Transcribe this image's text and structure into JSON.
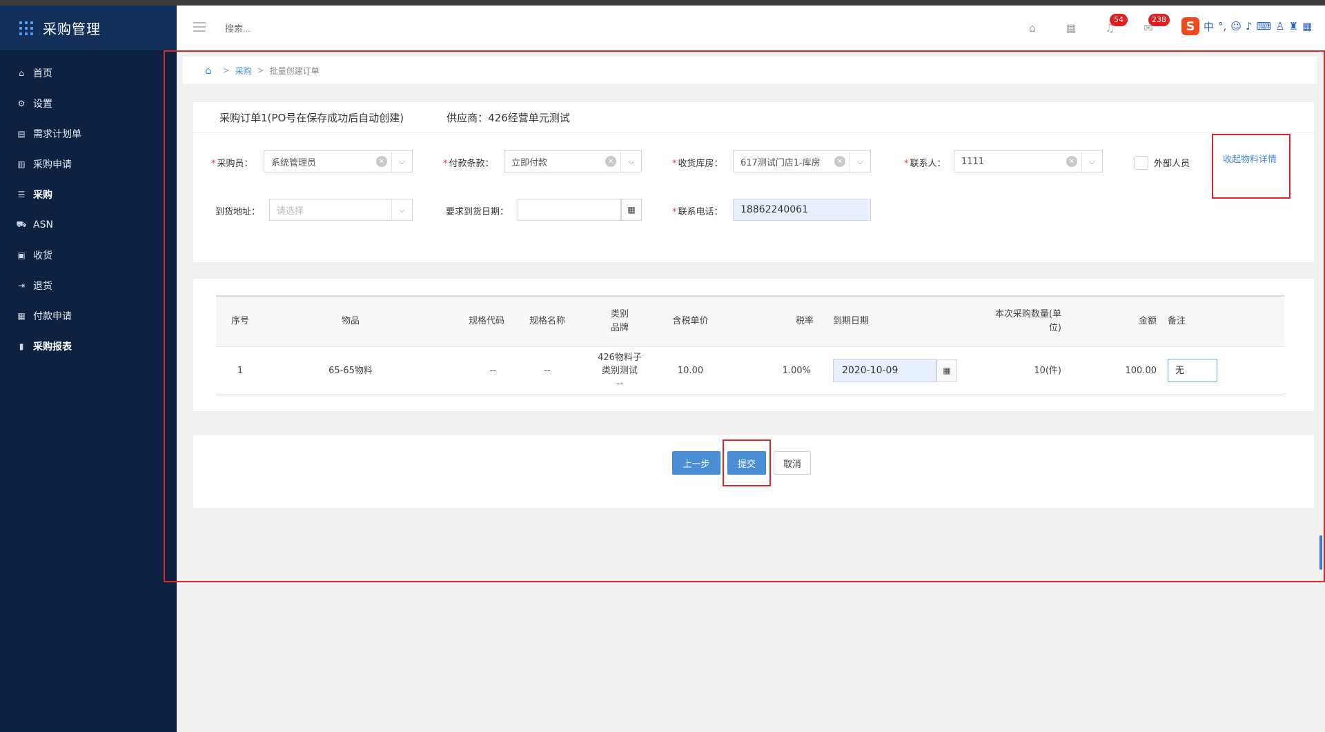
{
  "app": {
    "title": "采购管理"
  },
  "sidebar": {
    "items": [
      {
        "label": "首页",
        "icon": "home-icon"
      },
      {
        "label": "设置",
        "icon": "gear-icon"
      },
      {
        "label": "需求计划单",
        "icon": "document-icon"
      },
      {
        "label": "采购申请",
        "icon": "form-icon"
      },
      {
        "label": "采购",
        "icon": "list-icon"
      },
      {
        "label": "ASN",
        "icon": "truck-icon"
      },
      {
        "label": "收货",
        "icon": "inbox-icon"
      },
      {
        "label": "退货",
        "icon": "exit-icon"
      },
      {
        "label": "付款申请",
        "icon": "payment-icon"
      },
      {
        "label": "采购报表",
        "icon": "bar-chart-icon"
      }
    ]
  },
  "header": {
    "search_placeholder": "搜索...",
    "notif_count": "54",
    "message_count": "238",
    "ime_lang": "中"
  },
  "breadcrumb": {
    "level1": "采购",
    "level2": "批量创建订单"
  },
  "order": {
    "title": "采购订单1(PO号在保存成功后自动创建)",
    "supplier_label": "供应商：",
    "supplier_value": "426经营单元测试"
  },
  "form": {
    "buyer_label": "采购员：",
    "buyer_value": "系统管理员",
    "payment_label": "付款条款：",
    "payment_value": "立即付款",
    "warehouse_label": "收货库房：",
    "warehouse_value": "617测试门店1-库房",
    "contact_label": "联系人：",
    "contact_value": "1111",
    "external_label": "外部人员",
    "collapse_link": "收起物料详情",
    "address_label": "到货地址：",
    "address_placeholder": "请选择",
    "arrival_date_label": "要求到货日期：",
    "arrival_date_value": "",
    "phone_label": "联系电话：",
    "phone_value": "18862240061"
  },
  "table": {
    "headers": {
      "seq": "序号",
      "item": "物品",
      "spec_code": "规格代码",
      "spec_name": "规格名称",
      "category_line1": "类别",
      "category_line2": "品牌",
      "price": "含税单价",
      "tax": "税率",
      "due": "到期日期",
      "qty_line1": "本次采购数量(单",
      "qty_line2": "位)",
      "amount": "金额",
      "remark": "备注"
    },
    "rows": [
      {
        "seq": "1",
        "item": "65-65物料",
        "spec_code": "--",
        "spec_name": "--",
        "category_line1": "426物料子",
        "category_line2": "类别测试",
        "brand": "--",
        "price": "10.00",
        "tax": "1.00%",
        "due": "2020-10-09",
        "qty": "10(件)",
        "amount": "100.00",
        "remark": "无"
      }
    ]
  },
  "actions": {
    "prev": "上一步",
    "submit": "提交",
    "cancel": "取消"
  }
}
